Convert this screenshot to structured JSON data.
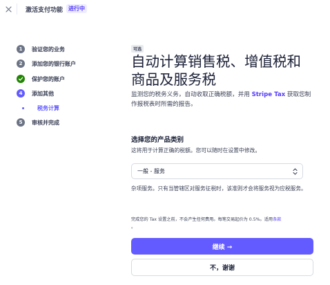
{
  "header": {
    "title": "激活支付功能",
    "badge": "进行中"
  },
  "steps": [
    {
      "num": "1",
      "label": "验证您的业务",
      "state": "pending"
    },
    {
      "num": "2",
      "label": "添加您的银行账户",
      "state": "pending"
    },
    {
      "num": "",
      "label": "保护您的账户",
      "state": "done"
    },
    {
      "num": "4",
      "label": "添加其他",
      "state": "active"
    },
    {
      "num": "5",
      "label": "审核并完成",
      "state": "pending"
    }
  ],
  "substep": {
    "label": "税务计算"
  },
  "main": {
    "badge": "可选",
    "headline": "自动计算销售税、增值税和商品及服务税",
    "desc_pre": "监测您的税务义务，自动收取正确税额，并用 ",
    "desc_link": "Stripe Tax",
    "desc_post": " 获取您制作报税表时所需的报告。",
    "section_title": "选择您的产品类别",
    "section_sub": "这将用于计算正确的税额。您可以随时在设置中修改。",
    "select_value": "一般 - 服务",
    "help": "杂项服务。只有当管辖区对服务征税时，该准则才会将服务视为应税服务。",
    "fine_pre": "完成您的 Tax 设置之前，不会产生任何费用。每笔交易起价为 0.5%。适用",
    "fine_link": "条款",
    "fine_post": "。",
    "continue_label": "继续 →",
    "decline_label": "不，谢谢"
  },
  "colors": {
    "accent": "#635bff",
    "done": "#228403",
    "step_pending": "#6b7385"
  }
}
